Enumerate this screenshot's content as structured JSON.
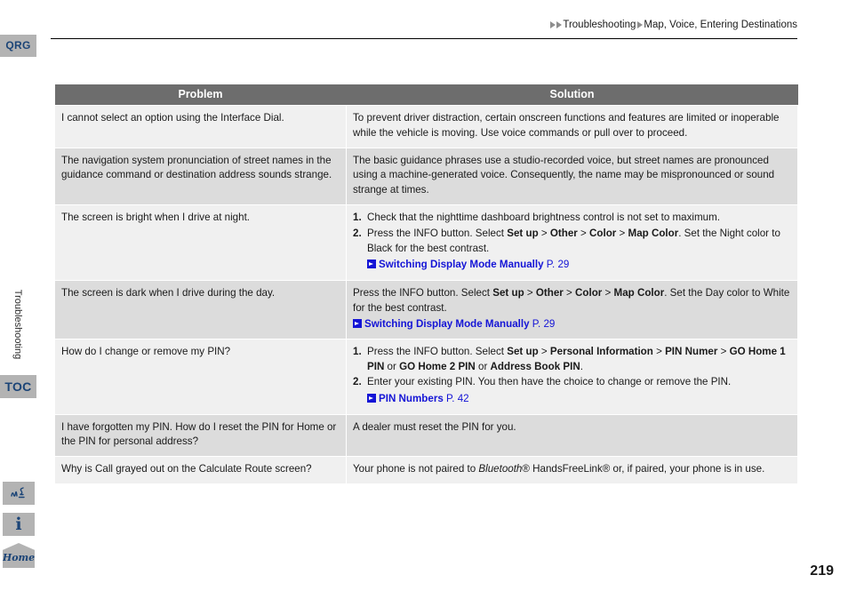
{
  "page": {
    "number": "219"
  },
  "rail": {
    "qrg_label": "QRG",
    "toc_label": "TOC",
    "section_label": "Troubleshooting",
    "voice_icon": "voice-command-icon",
    "info_icon": "information-icon",
    "home_label": "Home"
  },
  "header": {
    "crumb1": "Troubleshooting",
    "crumb2": "Map, Voice, Entering Destinations"
  },
  "table": {
    "headers": {
      "problem": "Problem",
      "solution": "Solution"
    },
    "rows": [
      {
        "problem": "I cannot select an option using the Interface Dial.",
        "solution_text": "To prevent driver distraction, certain onscreen functions and features are limited or inoperable while the vehicle is moving. Use voice commands or pull over to proceed."
      },
      {
        "problem": "The navigation system pronunciation of street names in the guidance command or destination address sounds strange.",
        "solution_text": "The basic guidance phrases use a studio-recorded voice, but street names are pronounced using a machine-generated voice. Consequently, the name may be mispronounced or sound strange at times."
      },
      {
        "problem": "The screen is bright when I drive at night.",
        "step1_num": "1.",
        "step1_text": "Check that the nighttime dashboard brightness control is not set to maximum.",
        "step2_num": "2.",
        "step2_a": "Press the INFO button. Select ",
        "step2_b1": "Set up",
        "step2_sep1": " > ",
        "step2_b2": "Other",
        "step2_sep2": " > ",
        "step2_b3": "Color",
        "step2_sep3": " > ",
        "step2_b4": "Map Color",
        "step2_c": ". Set the Night color to Black for the best contrast.",
        "ref_label": "Switching Display Mode Manually",
        "ref_page": "P. 29"
      },
      {
        "problem": "The screen is dark when I drive during the day.",
        "sol_a": "Press the INFO button. Select ",
        "sol_b1": "Set up",
        "sol_sep1": " > ",
        "sol_b2": "Other",
        "sol_sep2": " > ",
        "sol_b3": "Color",
        "sol_sep3": " > ",
        "sol_b4": "Map Color",
        "sol_c": ". Set the Day color to White for the best contrast.",
        "ref_label": "Switching Display Mode Manually",
        "ref_page": "P. 29"
      },
      {
        "problem": "How do I change or remove my PIN?",
        "step1_num": "1.",
        "step1_a": "Press the INFO button. Select ",
        "step1_b1": "Set up",
        "step1_sep1": " > ",
        "step1_b2": "Personal Information",
        "step1_sep2": " > ",
        "step1_b3": "PIN Numer",
        "step1_sep3": " > ",
        "step1_b4": "GO Home 1 PIN",
        "step1_or1": " or ",
        "step1_b5": "GO Home 2 PIN",
        "step1_or2": " or ",
        "step1_b6": "Address Book PIN",
        "step1_end": ".",
        "step2_num": "2.",
        "step2_text": "Enter your existing PIN. You then have the choice to change or remove the PIN.",
        "ref_label": "PIN Numbers",
        "ref_page": "P. 42"
      },
      {
        "problem": "I have forgotten my PIN. How do I reset the PIN for Home or the PIN for personal address?",
        "solution_text": "A dealer must reset the PIN for you."
      },
      {
        "problem": "Why is Call grayed out on the Calculate Route screen?",
        "sol_a": "Your phone is not paired to ",
        "sol_italic": "Bluetooth",
        "sol_b": "® HandsFreeLink® or, if paired, your phone is in use."
      }
    ]
  }
}
